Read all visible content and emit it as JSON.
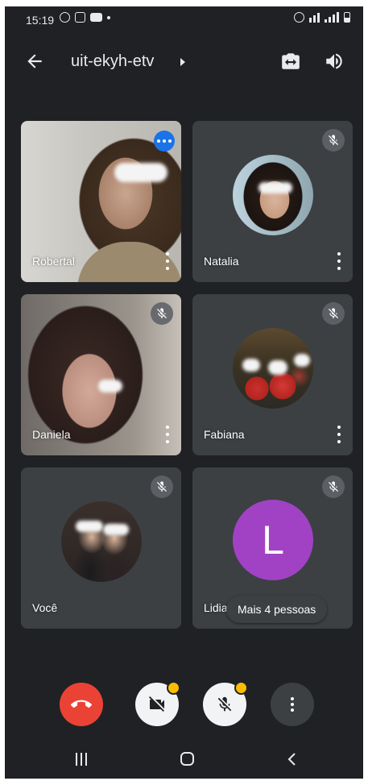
{
  "status_bar": {
    "time": "15:19"
  },
  "top_bar": {
    "meeting_code": "uit-ekyh-etv"
  },
  "participants": [
    {
      "name": "Robertal",
      "speaking": true,
      "muted": false
    },
    {
      "name": "Natalia",
      "speaking": false,
      "muted": true
    },
    {
      "name": "Daniela",
      "speaking": false,
      "muted": true
    },
    {
      "name": "Fabiana",
      "speaking": false,
      "muted": true
    },
    {
      "name": "Você",
      "speaking": false,
      "muted": true
    },
    {
      "name": "Lidia",
      "speaking": false,
      "muted": true,
      "avatar_letter": "L",
      "avatar_color": "#a142c5"
    }
  ],
  "more_participants_label": "Mais 4 pessoas",
  "icons": {
    "back": "arrow-left-icon",
    "switch_camera": "switch-camera-icon",
    "audio": "speaker-icon",
    "end_call": "phone-hangup-icon",
    "camera": "camera-off-icon",
    "mic": "mic-off-icon",
    "more": "more-vert-icon"
  },
  "colors": {
    "background": "#202124",
    "tile": "#3c4043",
    "end_call": "#ea4335",
    "warning": "#fbbc04",
    "speaking": "#1a73e8"
  }
}
